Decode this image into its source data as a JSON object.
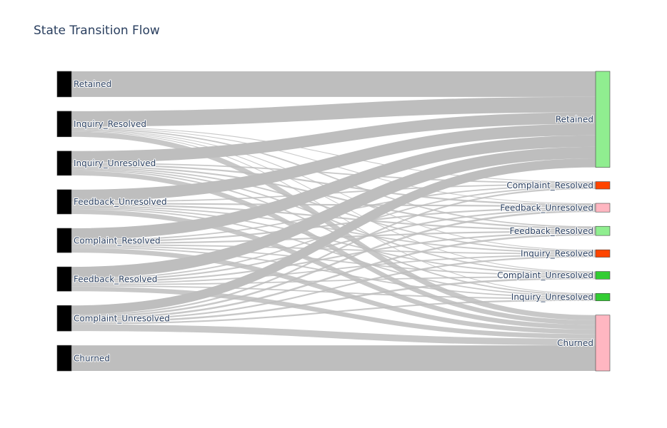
{
  "title": "State Transition Flow",
  "chart_data": {
    "type": "sankey",
    "link_color": "#bebebe",
    "source_nodes": [
      {
        "id": "Retained",
        "label": "Retained",
        "color": "#000000"
      },
      {
        "id": "Inquiry_Resolved",
        "label": "Inquiry_Resolved",
        "color": "#000000"
      },
      {
        "id": "Inquiry_Unresolved",
        "label": "Inquiry_Unresolved",
        "color": "#000000"
      },
      {
        "id": "Feedback_Unresolved",
        "label": "Feedback_Unresolved",
        "color": "#000000"
      },
      {
        "id": "Complaint_Resolved",
        "label": "Complaint_Resolved",
        "color": "#000000"
      },
      {
        "id": "Feedback_Resolved",
        "label": "Feedback_Resolved",
        "color": "#000000"
      },
      {
        "id": "Complaint_Unresolved",
        "label": "Complaint_Unresolved",
        "color": "#000000"
      },
      {
        "id": "Churned",
        "label": "Churned",
        "color": "#000000"
      }
    ],
    "target_nodes": [
      {
        "id": "Retained",
        "label": "Retained",
        "color": "#90ee90"
      },
      {
        "id": "Complaint_Resolved",
        "label": "Complaint_Resolved",
        "color": "#ff4500"
      },
      {
        "id": "Feedback_Unresolved",
        "label": "Feedback_Unresolved",
        "color": "#ffb6c1"
      },
      {
        "id": "Feedback_Resolved",
        "label": "Feedback_Resolved",
        "color": "#90ee90"
      },
      {
        "id": "Inquiry_Resolved",
        "label": "Inquiry_Resolved",
        "color": "#ff4500"
      },
      {
        "id": "Complaint_Unresolved",
        "label": "Complaint_Unresolved",
        "color": "#32cd32"
      },
      {
        "id": "Inquiry_Unresolved",
        "label": "Inquiry_Unresolved",
        "color": "#32cd32"
      },
      {
        "id": "Churned",
        "label": "Churned",
        "color": "#ffb6c1"
      }
    ],
    "links": [
      {
        "source": "Retained",
        "target": "Retained",
        "value": 10
      },
      {
        "source": "Inquiry_Resolved",
        "target": "Retained",
        "value": 6
      },
      {
        "source": "Inquiry_Resolved",
        "target": "Complaint_Resolved",
        "value": 0.3
      },
      {
        "source": "Inquiry_Resolved",
        "target": "Feedback_Unresolved",
        "value": 0.3
      },
      {
        "source": "Inquiry_Resolved",
        "target": "Feedback_Resolved",
        "value": 0.5
      },
      {
        "source": "Inquiry_Resolved",
        "target": "Inquiry_Resolved",
        "value": 0.3
      },
      {
        "source": "Inquiry_Resolved",
        "target": "Complaint_Unresolved",
        "value": 0.3
      },
      {
        "source": "Inquiry_Resolved",
        "target": "Inquiry_Unresolved",
        "value": 0.3
      },
      {
        "source": "Inquiry_Resolved",
        "target": "Churned",
        "value": 2
      },
      {
        "source": "Inquiry_Unresolved",
        "target": "Retained",
        "value": 4.5
      },
      {
        "source": "Inquiry_Unresolved",
        "target": "Complaint_Resolved",
        "value": 0.5
      },
      {
        "source": "Inquiry_Unresolved",
        "target": "Feedback_Unresolved",
        "value": 0.6
      },
      {
        "source": "Inquiry_Unresolved",
        "target": "Feedback_Resolved",
        "value": 0.6
      },
      {
        "source": "Inquiry_Unresolved",
        "target": "Inquiry_Resolved",
        "value": 0.5
      },
      {
        "source": "Inquiry_Unresolved",
        "target": "Complaint_Unresolved",
        "value": 0.5
      },
      {
        "source": "Inquiry_Unresolved",
        "target": "Inquiry_Unresolved",
        "value": 0.5
      },
      {
        "source": "Inquiry_Unresolved",
        "target": "Churned",
        "value": 1.8
      },
      {
        "source": "Feedback_Unresolved",
        "target": "Retained",
        "value": 4.5
      },
      {
        "source": "Feedback_Unresolved",
        "target": "Complaint_Resolved",
        "value": 0.5
      },
      {
        "source": "Feedback_Unresolved",
        "target": "Feedback_Unresolved",
        "value": 0.6
      },
      {
        "source": "Feedback_Unresolved",
        "target": "Feedback_Resolved",
        "value": 0.6
      },
      {
        "source": "Feedback_Unresolved",
        "target": "Inquiry_Resolved",
        "value": 0.5
      },
      {
        "source": "Feedback_Unresolved",
        "target": "Complaint_Unresolved",
        "value": 0.5
      },
      {
        "source": "Feedback_Unresolved",
        "target": "Inquiry_Unresolved",
        "value": 0.5
      },
      {
        "source": "Feedback_Unresolved",
        "target": "Churned",
        "value": 1.8
      },
      {
        "source": "Complaint_Resolved",
        "target": "Retained",
        "value": 4.5
      },
      {
        "source": "Complaint_Resolved",
        "target": "Complaint_Resolved",
        "value": 0.5
      },
      {
        "source": "Complaint_Resolved",
        "target": "Feedback_Unresolved",
        "value": 0.6
      },
      {
        "source": "Complaint_Resolved",
        "target": "Feedback_Resolved",
        "value": 0.6
      },
      {
        "source": "Complaint_Resolved",
        "target": "Inquiry_Resolved",
        "value": 0.5
      },
      {
        "source": "Complaint_Resolved",
        "target": "Complaint_Unresolved",
        "value": 0.5
      },
      {
        "source": "Complaint_Resolved",
        "target": "Inquiry_Unresolved",
        "value": 0.5
      },
      {
        "source": "Complaint_Resolved",
        "target": "Churned",
        "value": 1.8
      },
      {
        "source": "Feedback_Resolved",
        "target": "Retained",
        "value": 4.5
      },
      {
        "source": "Feedback_Resolved",
        "target": "Complaint_Resolved",
        "value": 0.5
      },
      {
        "source": "Feedback_Resolved",
        "target": "Feedback_Unresolved",
        "value": 0.6
      },
      {
        "source": "Feedback_Resolved",
        "target": "Feedback_Resolved",
        "value": 0.6
      },
      {
        "source": "Feedback_Resolved",
        "target": "Inquiry_Resolved",
        "value": 0.5
      },
      {
        "source": "Feedback_Resolved",
        "target": "Complaint_Unresolved",
        "value": 0.5
      },
      {
        "source": "Feedback_Resolved",
        "target": "Inquiry_Unresolved",
        "value": 0.5
      },
      {
        "source": "Feedback_Resolved",
        "target": "Churned",
        "value": 1.8
      },
      {
        "source": "Complaint_Unresolved",
        "target": "Retained",
        "value": 3.5
      },
      {
        "source": "Complaint_Unresolved",
        "target": "Complaint_Resolved",
        "value": 0.6
      },
      {
        "source": "Complaint_Unresolved",
        "target": "Feedback_Unresolved",
        "value": 0.7
      },
      {
        "source": "Complaint_Unresolved",
        "target": "Feedback_Resolved",
        "value": 0.7
      },
      {
        "source": "Complaint_Unresolved",
        "target": "Inquiry_Resolved",
        "value": 0.6
      },
      {
        "source": "Complaint_Unresolved",
        "target": "Complaint_Unresolved",
        "value": 0.7
      },
      {
        "source": "Complaint_Unresolved",
        "target": "Inquiry_Unresolved",
        "value": 0.6
      },
      {
        "source": "Complaint_Unresolved",
        "target": "Churned",
        "value": 2.6
      },
      {
        "source": "Churned",
        "target": "Churned",
        "value": 10
      }
    ]
  }
}
